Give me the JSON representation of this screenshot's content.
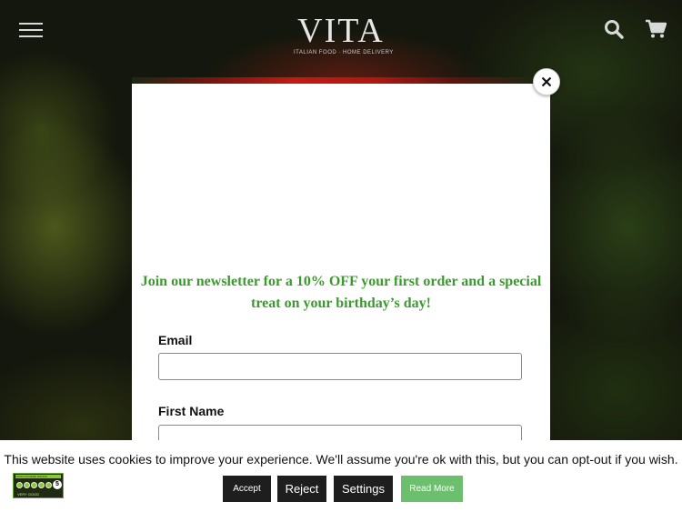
{
  "header": {
    "logo_text": "VITA",
    "logo_subtext": "ITALIAN FOOD · HOME DELIVERY",
    "menu_icon": "hamburger-menu-icon",
    "search_icon": "search-icon",
    "cart_icon": "shopping-cart-icon"
  },
  "popup": {
    "headline": "Join our newsletter for a 10% OFF your first order and a special treat on your birthday’s day!",
    "email_label": "Email",
    "email_value": "",
    "first_name_label": "First Name",
    "first_name_value": "",
    "close_icon": "close-icon"
  },
  "cookie_bar": {
    "message": "This website uses cookies to improve your experience. We'll assume you're ok with this, but you can opt-out if you wish.",
    "hygiene_badge": {
      "top_text": "FOOD HYGIENE RATING",
      "score": "5",
      "bottom_text": "VERY GOOD"
    },
    "buttons": {
      "accept": "Accept",
      "reject": "Reject",
      "settings": "Settings",
      "read_more": "Read More"
    }
  },
  "colors": {
    "headline_green": "#3b9a2e",
    "button_dark": "#1e1e1e",
    "read_more_green": "#6cbf6c",
    "overlay_bg": "#14170d"
  }
}
